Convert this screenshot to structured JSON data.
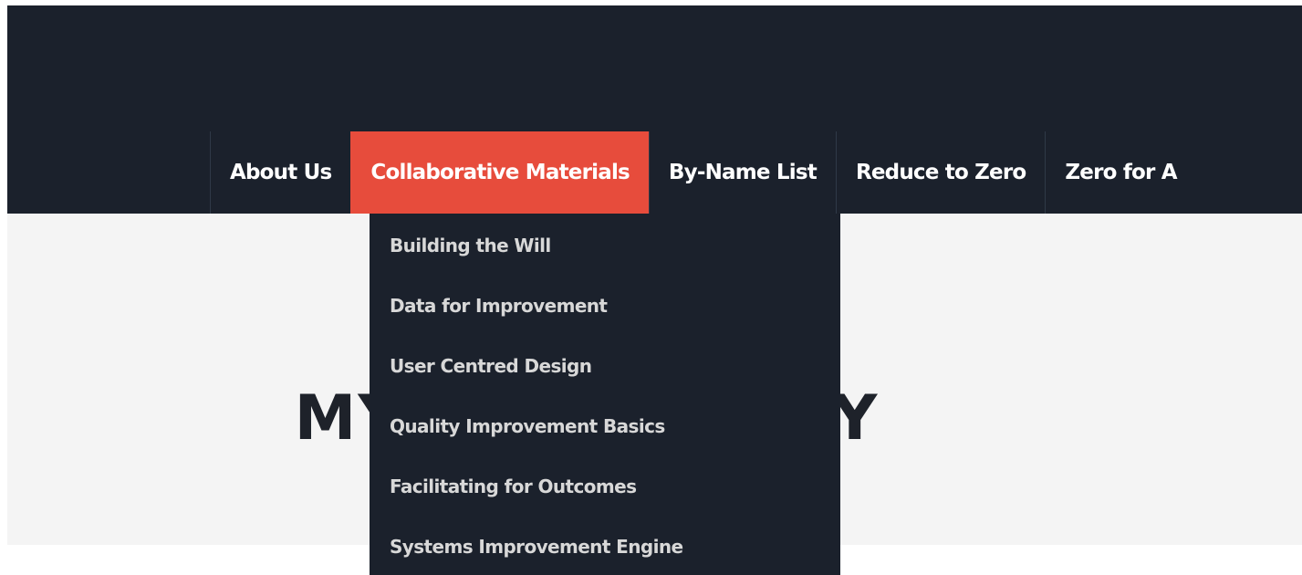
{
  "nav": {
    "items": [
      {
        "label": "About Us"
      },
      {
        "label": "Collaborative Materials",
        "active": true
      },
      {
        "label": "By-Name List"
      },
      {
        "label": "Reduce to Zero"
      },
      {
        "label": "Zero for A"
      }
    ]
  },
  "dropdown": {
    "items": [
      {
        "label": "Building the Will"
      },
      {
        "label": "Data for Improvement"
      },
      {
        "label": "User Centred Design"
      },
      {
        "label": "Quality Improvement Basics"
      },
      {
        "label": "Facilitating for Outcomes"
      },
      {
        "label": "Systems Improvement Engine"
      }
    ]
  },
  "hero": {
    "title": "MY COMMUNITY"
  },
  "colors": {
    "header_bg": "#1b212c",
    "accent": "#e74c3c",
    "hero_bg": "#f4f4f4"
  }
}
